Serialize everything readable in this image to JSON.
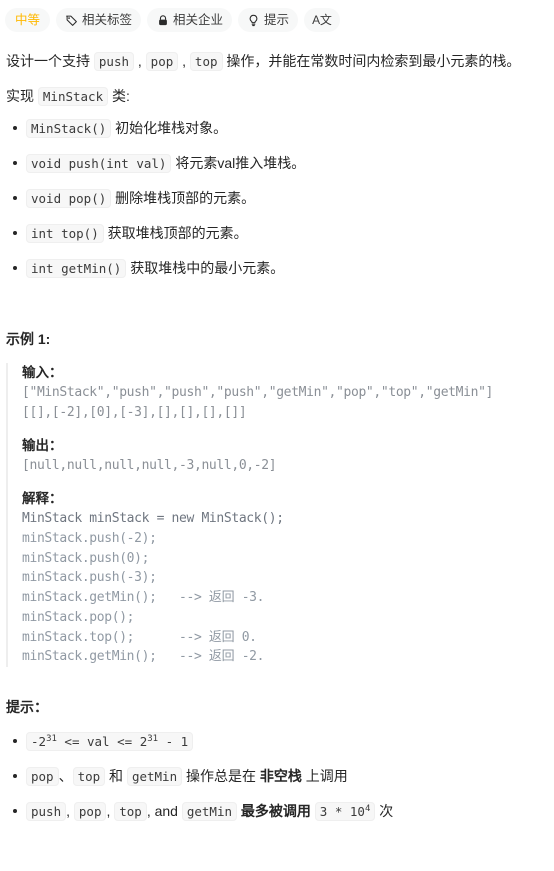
{
  "toolbar": {
    "difficulty": {
      "label": "中等",
      "color": "#ffb800"
    },
    "tags": {
      "label": "相关标签",
      "icon": "tag-icon"
    },
    "companies": {
      "label": "相关企业",
      "icon": "lock-icon"
    },
    "hint": {
      "label": "提示",
      "icon": "lightbulb-icon"
    },
    "font_toggle": {
      "label": "A文",
      "icon": "font-size-icon"
    }
  },
  "description": {
    "line1_a": "设计一个支持 ",
    "code_push": "push",
    "sep1": " , ",
    "code_pop": "pop",
    "sep2": " , ",
    "code_top": "top",
    "line1_b": " 操作，并能在常数时间内检索到最小元素的栈。",
    "line2_a": "实现 ",
    "code_minstack": "MinStack",
    "line2_b": " 类:"
  },
  "methods": [
    {
      "code": "MinStack()",
      "text": " 初始化堆栈对象。"
    },
    {
      "code": "void push(int val)",
      "text": " 将元素val推入堆栈。"
    },
    {
      "code": "void pop()",
      "text": " 删除堆栈顶部的元素。"
    },
    {
      "code": "int top()",
      "text": " 获取堆栈顶部的元素。"
    },
    {
      "code": "int getMin()",
      "text": " 获取堆栈中的最小元素。"
    }
  ],
  "example": {
    "title": "示例 1:",
    "input_label": "输入：",
    "input_value": "[\"MinStack\",\"push\",\"push\",\"push\",\"getMin\",\"pop\",\"top\",\"getMin\"]\n[[],[-2],[0],[-3],[],[],[],[]]",
    "output_label": "输出：",
    "output_value": "[null,null,null,null,-3,null,0,-2]",
    "explain_label": "解释：",
    "explain_head": "MinStack minStack = new MinStack();",
    "explain_rest": "minStack.push(-2);\nminStack.push(0);\nminStack.push(-3);\nminStack.getMin();   --> 返回 -3.\nminStack.pop();\nminStack.top();      --> 返回 0.\nminStack.getMin();   --> 返回 -2."
  },
  "hints": {
    "title": "提示：",
    "item1": {
      "code_pre": "-2",
      "sup1": "31",
      "code_mid": " <= val <= 2",
      "sup2": "31",
      "code_post": " - 1"
    },
    "item2": {
      "c1": "pop",
      "t1": "、",
      "c2": "top",
      "t2": " 和 ",
      "c3": "getMin",
      "t3": " 操作总是在 ",
      "bold": "非空栈",
      "t4": " 上调用"
    },
    "item3": {
      "c1": "push",
      "t1": ", ",
      "c2": "pop",
      "t2": ", ",
      "c3": "top",
      "t3": ", and ",
      "c4": "getMin",
      "t4": " 最多被调用 ",
      "c5_pre": "3 * 10",
      "c5_sup": "4",
      "t5": " 次"
    }
  }
}
